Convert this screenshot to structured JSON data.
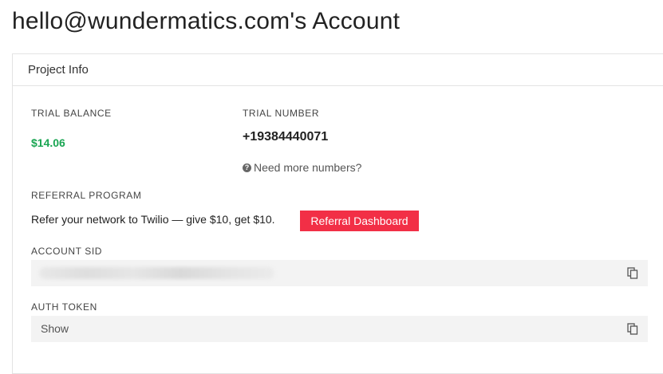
{
  "page": {
    "title": "hello@wundermatics.com's Account"
  },
  "project_info": {
    "header": "Project Info",
    "trial_balance_label": "TRIAL BALANCE",
    "trial_balance_value": "$14.06",
    "trial_number_label": "TRIAL NUMBER",
    "trial_number_value": "+19384440071",
    "more_numbers_link": "Need more numbers?",
    "referral_label": "REFERRAL PROGRAM",
    "referral_text": "Refer your network to Twilio — give $10, get $10.",
    "referral_button": "Referral Dashboard",
    "account_sid_label": "ACCOUNT SID",
    "auth_token_label": "AUTH TOKEN",
    "auth_token_show": "Show"
  },
  "icons": {
    "help": "question-circle-icon",
    "copy": "copy-icon"
  },
  "colors": {
    "balance_green": "#19a552",
    "referral_button_bg": "#f22f46"
  }
}
